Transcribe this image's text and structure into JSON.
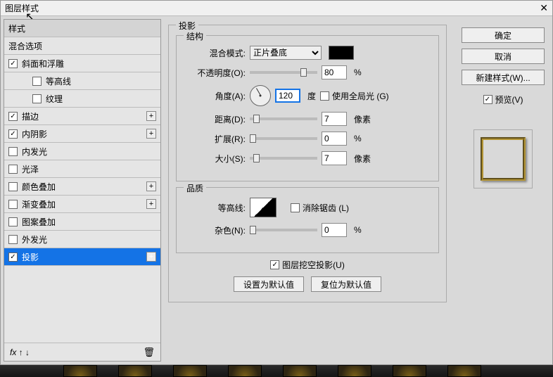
{
  "dialog": {
    "title": "图层样式"
  },
  "left": {
    "header": "样式",
    "blend": "混合选项",
    "items": [
      {
        "label": "斜面和浮雕",
        "checked": true,
        "plus": false,
        "indent": false
      },
      {
        "label": "等高线",
        "checked": false,
        "plus": false,
        "indent": true
      },
      {
        "label": "纹理",
        "checked": false,
        "plus": false,
        "indent": true
      },
      {
        "label": "描边",
        "checked": true,
        "plus": true,
        "indent": false
      },
      {
        "label": "内阴影",
        "checked": true,
        "plus": true,
        "indent": false
      },
      {
        "label": "内发光",
        "checked": false,
        "plus": false,
        "indent": false
      },
      {
        "label": "光泽",
        "checked": false,
        "plus": false,
        "indent": false
      },
      {
        "label": "颜色叠加",
        "checked": false,
        "plus": true,
        "indent": false
      },
      {
        "label": "渐变叠加",
        "checked": false,
        "plus": true,
        "indent": false
      },
      {
        "label": "图案叠加",
        "checked": false,
        "plus": false,
        "indent": false
      },
      {
        "label": "外发光",
        "checked": false,
        "plus": false,
        "indent": false
      },
      {
        "label": "投影",
        "checked": true,
        "plus": true,
        "indent": false,
        "selected": true
      }
    ],
    "fx": "fx"
  },
  "shadow": {
    "panel_title": "投影",
    "structure": {
      "title": "结构",
      "blend_mode_label": "混合模式:",
      "blend_mode_value": "正片叠底",
      "opacity_label": "不透明度(O):",
      "opacity_value": "80",
      "opacity_unit": "%",
      "angle_label": "角度(A):",
      "angle_value": "120",
      "angle_unit": "度",
      "global_light": "使用全局光 (G)",
      "global_light_checked": false,
      "distance_label": "距离(D):",
      "distance_value": "7",
      "distance_unit": "像素",
      "spread_label": "扩展(R):",
      "spread_value": "0",
      "spread_unit": "%",
      "size_label": "大小(S):",
      "size_value": "7",
      "size_unit": "像素"
    },
    "quality": {
      "title": "品质",
      "contour_label": "等高线:",
      "anti_alias": "消除锯齿 (L)",
      "noise_label": "杂色(N):",
      "noise_value": "0",
      "noise_unit": "%"
    },
    "knockout": "图层挖空投影(U)",
    "knockout_checked": true,
    "set_default": "设置为默认值",
    "reset_default": "复位为默认值"
  },
  "right": {
    "ok": "确定",
    "cancel": "取消",
    "new_style": "新建样式(W)...",
    "preview": "预览(V)",
    "preview_checked": true
  }
}
